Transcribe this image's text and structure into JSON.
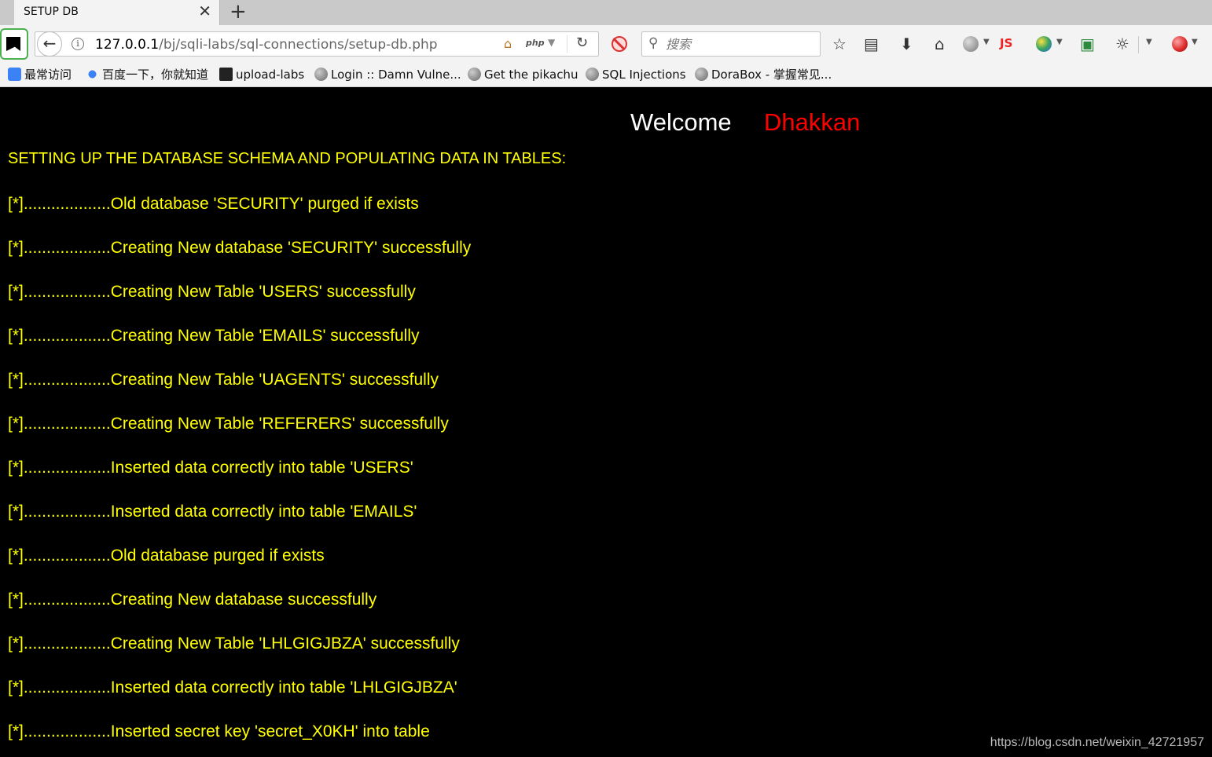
{
  "browser": {
    "tab": {
      "title": "SETUP DB",
      "close": "✕"
    },
    "new_tab": "+",
    "url": {
      "host": "127.0.0.1",
      "path": "/bj/sqli-labs/sql-connections/setup-db.php"
    },
    "url_badge": "php",
    "search": {
      "placeholder": "搜索"
    },
    "toolbar_icons": [
      "noscript-icon",
      "back-icon",
      "info-icon",
      "home-icon",
      "reload-icon",
      "adblock-icon",
      "search-icon",
      "star-icon",
      "reading-list-icon",
      "download-icon",
      "home-icon",
      "globe-icon",
      "js-icon",
      "color-globe-icon",
      "image-icon",
      "palette-icon",
      "addon-icon"
    ],
    "js_label": "JS",
    "bookmarks": [
      {
        "label": "最常访问",
        "icon": "most-visited-icon"
      },
      {
        "label": "百度一下，你就知道",
        "icon": "baidu-icon"
      },
      {
        "label": "upload-labs",
        "icon": "folder-icon"
      },
      {
        "label": "Login :: Damn Vulne...",
        "icon": "globe-icon"
      },
      {
        "label": "Get the pikachu",
        "icon": "globe-icon"
      },
      {
        "label": "SQL Injections",
        "icon": "globe-icon"
      },
      {
        "label": "DoraBox - 掌握常见...",
        "icon": "globe-icon"
      }
    ]
  },
  "page": {
    "welcome": "Welcome",
    "name": "Dhakkan",
    "heading": "SETTING UP THE DATABASE SCHEMA AND POPULATING DATA IN TABLES:",
    "log": [
      "[*]...................Old database 'SECURITY' purged if exists",
      "[*]...................Creating New database 'SECURITY' successfully",
      "[*]...................Creating New Table 'USERS' successfully",
      "[*]...................Creating New Table 'EMAILS' successfully",
      "[*]...................Creating New Table 'UAGENTS' successfully",
      "[*]...................Creating New Table 'REFERERS' successfully",
      "[*]...................Inserted data correctly into table 'USERS'",
      "[*]...................Inserted data correctly into table 'EMAILS'",
      "[*]...................Old database purged if exists",
      "[*]...................Creating New database successfully",
      "[*]...................Creating New Table 'LHLGIGJBZA' successfully",
      "[*]...................Inserted data correctly into table 'LHLGIGJBZA'",
      "[*]...................Inserted secret key 'secret_X0KH' into table"
    ],
    "watermark": "https://blog.csdn.net/weixin_42721957"
  },
  "colors": {
    "background": "#000000",
    "log_text": "#ffff00",
    "name": "#ff0000",
    "welcome": "#ffffff"
  }
}
